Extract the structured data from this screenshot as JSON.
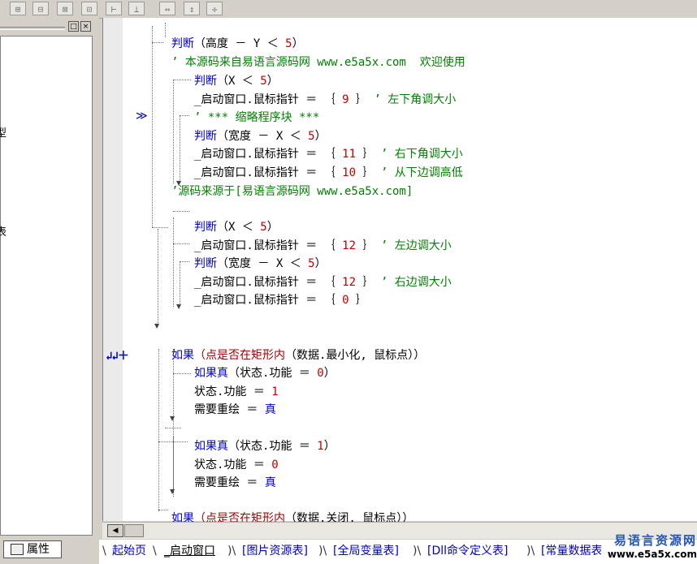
{
  "toolbar": {
    "buttons": [
      "align-left-icon",
      "align-top-icon",
      "align-vcenter-icon",
      "align-hcenter-icon",
      "same-width-icon",
      "same-height-icon",
      "width-icon",
      "height-icon",
      "center-icon"
    ]
  },
  "left_panel": {
    "win_restore": "□",
    "win_close": "×",
    "cut_text_1": "型",
    "cut_text_2": "表",
    "props_tab": "属性"
  },
  "gutter": {
    "marker": "≫",
    "cursor_icons": "↲↲＋"
  },
  "code_lines": {
    "l1_kw": "判断",
    "l1_rest": "（高度 － Y ＜ ",
    "l1_num": "5",
    "l1_end": "）",
    "l2": "’ 本源码来自易语言源码网 www.e5a5x.com  欢迎使用",
    "l3_kw": "判断",
    "l3_rest": "（X ＜ ",
    "l3_num": "5",
    "l3_end": "）",
    "l4_a": "_启动窗口.鼠标指针 ＝ ｛ ",
    "l4_num": "9",
    "l4_b": " ｝ ",
    "l4_cm": "’ 左下角调大小",
    "l5": "’ *** 缩略程序块 ***",
    "l6_kw": "判断",
    "l6_rest": "（宽度 － X ＜ ",
    "l6_num": "5",
    "l6_end": "）",
    "l7_a": "_启动窗口.鼠标指针 ＝ ｛ ",
    "l7_num": "11",
    "l7_b": " ｝ ",
    "l7_cm": "’ 右下角调大小",
    "l8_a": "_启动窗口.鼠标指针 ＝ ｛ ",
    "l8_num": "10",
    "l8_b": " ｝ ",
    "l8_cm": "’ 从下边调高低",
    "l9": "’源码来源于[易语言源码网 www.e5a5x.com]",
    "l10_kw": "判断",
    "l10_rest": "（X ＜ ",
    "l10_num": "5",
    "l10_end": "）",
    "l11_a": "_启动窗口.鼠标指针 ＝ ｛ ",
    "l11_num": "12",
    "l11_b": " ｝ ",
    "l11_cm": "’ 左边调大小",
    "l12_kw": "判断",
    "l12_rest": "（宽度 － X ＜ ",
    "l12_num": "5",
    "l12_end": "）",
    "l13_a": "_启动窗口.鼠标指针 ＝ ｛ ",
    "l13_num": "12",
    "l13_b": " ｝ ",
    "l13_cm": "’ 右边调大小",
    "l14_a": "_启动窗口.鼠标指针 ＝ ｛ ",
    "l14_num": "0",
    "l14_b": " ｝",
    "l15_kw": "如果",
    "l15_fn": "（点是否在矩形内",
    "l15_rest": "（数据.最小化, 鼠标点））",
    "l16_kw": "如果真",
    "l16_rest": "（状态.功能 ＝ ",
    "l16_num": "0",
    "l16_end": "）",
    "l17_a": "状态.功能 ＝ ",
    "l17_num": "1",
    "l18_a": "需要重绘 ＝ ",
    "l18_kw": "真",
    "l19_kw": "如果真",
    "l19_rest": "（状态.功能 ＝ ",
    "l19_num": "1",
    "l19_end": "）",
    "l20_a": "状态.功能 ＝ ",
    "l20_num": "0",
    "l21_a": "需要重绘 ＝ ",
    "l21_kw": "真",
    "l22_kw": "如果",
    "l22_fn": "（点是否在矩形内",
    "l22_rest": "（数据.关闭, 鼠标点））"
  },
  "scrollbar": {
    "left_arrow": "◀"
  },
  "tabs": [
    {
      "label": "起始页"
    },
    {
      "label": "_启动窗口"
    },
    {
      "label": "[图片资源表]"
    },
    {
      "label": "[全局变量表]"
    },
    {
      "label": "[Dll命令定义表]"
    },
    {
      "label": "[常量数据表"
    }
  ],
  "watermark": {
    "line1": "易语言资源网",
    "line2": "www.e5a5x.com"
  },
  "colors": {
    "keyword": "#0000d0",
    "comment": "#008000",
    "number": "#c00000",
    "tab_text": "#0000c0"
  }
}
